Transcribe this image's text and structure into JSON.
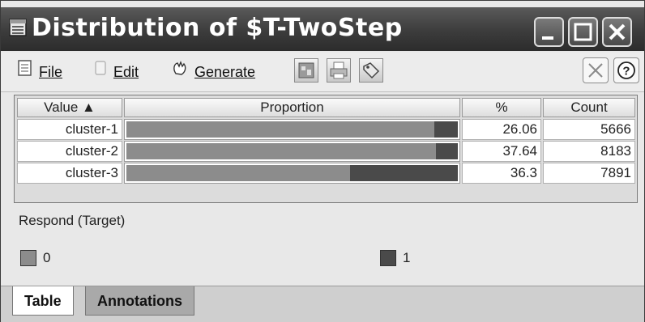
{
  "window": {
    "title": "Distribution of $T-TwoStep",
    "icon": "table-window-icon",
    "controls": [
      "minimize-icon",
      "maximize-icon",
      "close-icon"
    ]
  },
  "toolbar": {
    "file_label": "File",
    "edit_label": "Edit",
    "generate_label": "Generate",
    "icon_buttons": [
      "chart-icon",
      "print-icon",
      "tag-icon"
    ],
    "close_icon": "close-x-icon",
    "help_icon": "help-icon"
  },
  "table": {
    "columns": [
      "Value ▲",
      "Proportion",
      "%",
      "Count"
    ],
    "rows": [
      {
        "value": "cluster-1",
        "percent": "26.06",
        "count": "5666",
        "proportion_0": 0.93,
        "proportion_1": 0.07
      },
      {
        "value": "cluster-2",
        "percent": "37.64",
        "count": "8183",
        "proportion_0": 0.935,
        "proportion_1": 0.065
      },
      {
        "value": "cluster-3",
        "percent": "36.3",
        "count": "7891",
        "proportion_0": 0.675,
        "proportion_1": 0.325
      }
    ]
  },
  "legend": {
    "title": "Respond (Target)",
    "items": [
      {
        "label": "0",
        "color": "#8c8c8c"
      },
      {
        "label": "1",
        "color": "#4a4a4a"
      }
    ]
  },
  "tabs": [
    {
      "label": "Table",
      "active": true
    },
    {
      "label": "Annotations",
      "active": false
    }
  ]
}
